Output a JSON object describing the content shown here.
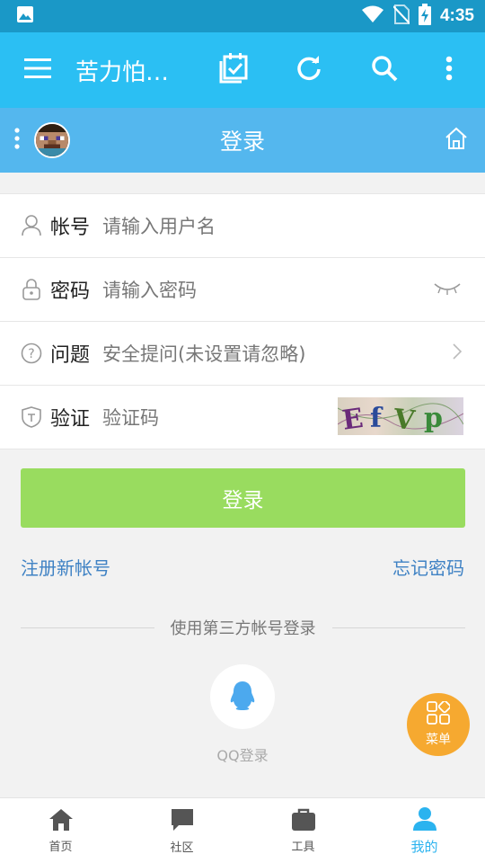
{
  "status_bar": {
    "time": "4:35"
  },
  "app_bar": {
    "title": "苦力怕…",
    "icons": [
      "menu-icon",
      "calendar-check-icon",
      "refresh-icon",
      "search-icon",
      "more-vert-icon"
    ]
  },
  "sub_bar": {
    "title": "登录"
  },
  "form": {
    "account": {
      "label": "帐号",
      "placeholder": "请输入用户名"
    },
    "password": {
      "label": "密码",
      "placeholder": "请输入密码"
    },
    "question": {
      "label": "问题",
      "placeholder": "安全提问(未设置请忽略)"
    },
    "verify": {
      "label": "验证",
      "placeholder": "验证码"
    }
  },
  "login_button": "登录",
  "links": {
    "register": "注册新帐号",
    "forgot": "忘记密码"
  },
  "third_party": {
    "heading": "使用第三方帐号登录",
    "qq_label": "QQ登录"
  },
  "fab": {
    "label": "菜单"
  },
  "tabs": [
    {
      "label": "首页",
      "icon": "home-icon",
      "active": false
    },
    {
      "label": "社区",
      "icon": "chat-icon",
      "active": false
    },
    {
      "label": "工具",
      "icon": "toolbox-icon",
      "active": false
    },
    {
      "label": "我的",
      "icon": "person-icon",
      "active": true
    }
  ],
  "colors": {
    "status_bar": "#1a98c7",
    "app_bar": "#2bbff3",
    "sub_bar": "#54b7ee",
    "login_button": "#99dc5f",
    "link": "#3f82c4",
    "fab": "#f6a930",
    "tab_active": "#2bb3ef"
  }
}
